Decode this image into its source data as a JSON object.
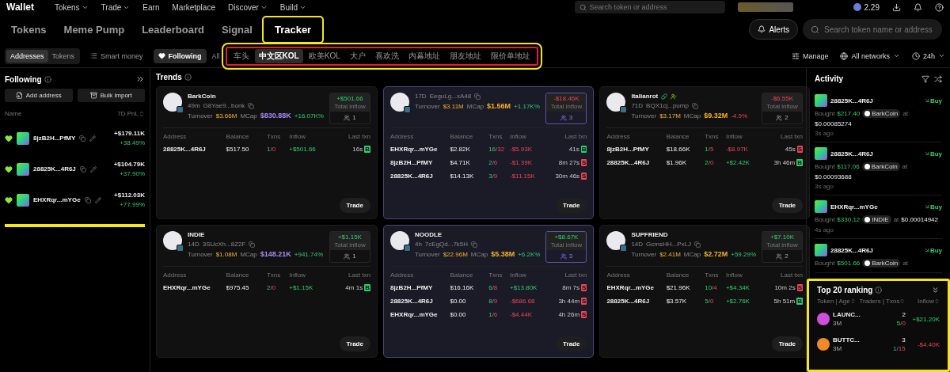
{
  "top_nav": {
    "logo": "Wallet",
    "menus": [
      {
        "label": "Tokens",
        "dropdown": true
      },
      {
        "label": "Trade",
        "dropdown": true
      },
      {
        "label": "Earn",
        "dropdown": false
      },
      {
        "label": "Marketplace",
        "dropdown": false
      },
      {
        "label": "Discover",
        "dropdown": true
      },
      {
        "label": "Build",
        "dropdown": true
      }
    ],
    "search_placeholder": "Search token or address",
    "balance": "2.29"
  },
  "tabs": [
    {
      "label": "Tokens",
      "selected": false,
      "highlighted": false
    },
    {
      "label": "Meme Pump",
      "selected": false,
      "highlighted": false
    },
    {
      "label": "Leaderboard",
      "selected": false,
      "highlighted": false
    },
    {
      "label": "Signal",
      "selected": false,
      "highlighted": false
    },
    {
      "label": "Tracker",
      "selected": true,
      "highlighted": true
    }
  ],
  "alerts_button": "Alerts",
  "search": {
    "placeholder": "Search token name or address"
  },
  "filters": {
    "segments": [
      {
        "label": "Addresses",
        "selected": true
      },
      {
        "label": "Tokens",
        "selected": false
      }
    ],
    "toggles": [
      {
        "label": "Smart money",
        "selected": false
      },
      {
        "label": "Following",
        "selected": true
      }
    ],
    "all": "All",
    "chips_highlighted": true,
    "chips": [
      {
        "label": "车头",
        "selected": false
      },
      {
        "label": "中文区KOL",
        "selected": true
      },
      {
        "label": "欧美KOL",
        "selected": false
      },
      {
        "label": "大户",
        "selected": false
      },
      {
        "label": "喜欢洗",
        "selected": false
      },
      {
        "label": "内幕地址",
        "selected": false
      },
      {
        "label": "朋友地址",
        "selected": false
      },
      {
        "label": "限价单地址",
        "selected": false
      }
    ],
    "manage": "Manage",
    "network": "All networks",
    "period": "24h"
  },
  "following": {
    "title": "Following",
    "add_button": "Add address",
    "import_button": "Bulk import",
    "col_name": "Name",
    "col_pnl": "7D PnL",
    "marked": true,
    "rows": [
      {
        "address": "8jzB2H...PfMY",
        "pnl": "+$179.11K",
        "pct": "+38.49%",
        "followed": true
      },
      {
        "address": "28825K...4R6J",
        "pnl": "+$104.79K",
        "pct": "+37.90%",
        "followed": true
      },
      {
        "address": "EHXRqr...mYGe",
        "pnl": "+$112.03K",
        "pct": "+77.99%",
        "followed": true
      }
    ]
  },
  "trends": {
    "title": "Trends",
    "cards": [
      {
        "name": "BarkCoin",
        "age": "49m",
        "address": "G8Yae9...bonk",
        "turnover_label": "Turnover",
        "turnover": "$3.66M",
        "mcap_label": "MCap",
        "mcap": {
          "value": "$830.88K",
          "color": "#a78bfa"
        },
        "change": "+16.07K%",
        "change_up": true,
        "inflow": "+$501.66",
        "inflow_up": true,
        "inflow_label": "Total inflow",
        "traders": "1",
        "selected": false,
        "tagged": false,
        "columns": [
          "Address",
          "Balance",
          "Txns",
          "Inflow",
          "Last txn"
        ],
        "trade": "Trade",
        "rows": [
          {
            "address": "28825K...4R6J",
            "balance": "$517.50",
            "txns": [
              "1",
              "/",
              "0"
            ],
            "inflow": "+$501.66",
            "up": true,
            "time": "16s",
            "side": {
              "label": "B",
              "kind": "buy"
            }
          }
        ]
      },
      {
        "age": "17D",
        "address": "EeguLg...xA48",
        "turnover_label": "Turnover",
        "turnover": "$3.11M",
        "mcap_label": "MCap",
        "mcap": {
          "value": "$1.56M",
          "color": "#f5b324"
        },
        "change": "+1.17K%",
        "change_up": true,
        "inflow": "-$18.46K",
        "inflow_up": false,
        "inflow_label": "Total inflow",
        "traders": "3",
        "selected": true,
        "tagged": false,
        "columns": [
          "Address",
          "Balance",
          "Txns",
          "Inflow",
          "Last txn"
        ],
        "trade": "Trade",
        "rows": [
          {
            "address": "EHXRqr...mYGe",
            "balance": "$2.82K",
            "txns": [
              "16",
              "/",
              "32"
            ],
            "inflow": "-$5.93K",
            "up": false,
            "time": "41s",
            "side": {
              "label": "B",
              "kind": "buy"
            }
          },
          {
            "address": "8jzB2H...PfMY",
            "balance": "$4.71K",
            "txns": [
              "2",
              "/",
              "6"
            ],
            "inflow": "-$1.39K",
            "up": false,
            "time": "8m 27s",
            "side": {
              "label": "S",
              "kind": "sell"
            }
          },
          {
            "address": "28825K...4R6J",
            "balance": "$14.13K",
            "txns": [
              "3",
              "/",
              "9"
            ],
            "inflow": "-$11.15K",
            "up": false,
            "time": "30m 46s",
            "side": {
              "label": "S",
              "kind": "sell"
            }
          }
        ]
      },
      {
        "name": "Italianrot",
        "age": "71D",
        "address": "BQX1cj...pump",
        "turnover_label": "Turnover",
        "turnover": "$3.17M",
        "mcap_label": "MCap",
        "mcap": {
          "value": "$9.32M",
          "color": "#f5b324"
        },
        "change": "-4.9%",
        "change_up": false,
        "inflow": "-$6.55K",
        "inflow_up": false,
        "inflow_label": "Total inflow",
        "traders": "2",
        "selected": false,
        "tagged": true,
        "columns": [
          "Address",
          "Balance",
          "Txns",
          "Inflow",
          "Last txn"
        ],
        "trade": "Trade",
        "rows": [
          {
            "address": "8jzB2H...PfMY",
            "balance": "$18.66K",
            "txns": [
              "1",
              "/",
              "5"
            ],
            "inflow": "-$8.97K",
            "up": false,
            "time": "45s",
            "side": {
              "label": "S",
              "kind": "sell"
            }
          },
          {
            "address": "28825K...4R6J",
            "balance": "$1.96K",
            "txns": [
              "2",
              "/",
              "0"
            ],
            "inflow": "+$2.42K",
            "up": true,
            "time": "3h 46m",
            "side": {
              "label": "B",
              "kind": "buy"
            }
          }
        ]
      },
      {
        "name": "INDIE",
        "age": "14D",
        "address": "3SUcXh...8Z2F",
        "turnover_label": "Turnover",
        "turnover": "$1.08M",
        "mcap_label": "MCap",
        "mcap": {
          "value": "$148.21K",
          "color": "#a78bfa"
        },
        "change": "+941.74%",
        "change_up": true,
        "inflow": "+$1.15K",
        "inflow_up": true,
        "inflow_label": "Total inflow",
        "traders": "1",
        "selected": false,
        "tagged": false,
        "columns": [
          "Address",
          "Balance",
          "Txns",
          "Inflow",
          "Last txn"
        ],
        "trade": "Trade",
        "rows": [
          {
            "address": "EHXRqr...mYGe",
            "balance": "$975.45",
            "txns": [
              "2",
              "/",
              "0"
            ],
            "inflow": "+$1.15K",
            "up": true,
            "time": "4m 1s",
            "side": {
              "label": "B",
              "kind": "buy"
            }
          }
        ]
      },
      {
        "name": "NOODLE",
        "age": "4h",
        "address": "7cEgQd...7k5H",
        "turnover_label": "Turnover",
        "turnover": "$22.96M",
        "mcap_label": "MCap",
        "mcap": {
          "value": "$5.38M",
          "color": "#f5b324"
        },
        "change": "+6.2K%",
        "change_up": true,
        "inflow": "+$8.67K",
        "inflow_up": true,
        "inflow_label": "Total inflow",
        "traders": "3",
        "selected": true,
        "tagged": false,
        "columns": [
          "Address",
          "Balance",
          "Txns",
          "Inflow",
          "Last txn"
        ],
        "trade": "Trade",
        "rows": [
          {
            "address": "8jzB2H...PfMY",
            "balance": "$16.16K",
            "txns": [
              "6",
              "/",
              "8"
            ],
            "inflow": "+$13.80K",
            "up": true,
            "time": "8m 7s",
            "side": {
              "label": "S",
              "kind": "sell"
            }
          },
          {
            "address": "28825K...4R6J",
            "balance": "$0.00",
            "txns": [
              "8",
              "/",
              "9"
            ],
            "inflow": "-$686.68",
            "up": false,
            "time": "3h 44m",
            "side": {
              "label": "S",
              "kind": "sell"
            }
          },
          {
            "address": "EHXRqr...mYGe",
            "balance": "$0.00",
            "txns": [
              "1",
              "/",
              "6"
            ],
            "inflow": "-$4.44K",
            "up": false,
            "time": "4h 26m",
            "side": {
              "label": "S",
              "kind": "sell"
            }
          }
        ]
      },
      {
        "name": "SUPFRIEND",
        "age": "14D",
        "address": "GcmsHH...PxLJ",
        "turnover_label": "Turnover",
        "turnover": "$2.41M",
        "mcap_label": "MCap",
        "mcap": {
          "value": "$2.72M",
          "color": "#f5b324"
        },
        "change": "+59.29%",
        "change_up": true,
        "inflow": "+$7.10K",
        "inflow_up": true,
        "inflow_label": "Total inflow",
        "traders": "2",
        "selected": false,
        "tagged": false,
        "columns": [
          "Address",
          "Balance",
          "Txns",
          "Inflow",
          "Last txn"
        ],
        "trade": "Trade",
        "rows": [
          {
            "address": "EHXRqr...mYGe",
            "balance": "$21.96K",
            "txns": [
              "10",
              "/",
              "4"
            ],
            "inflow": "+$4.34K",
            "up": true,
            "time": "10m 2s",
            "side": {
              "label": "S",
              "kind": "sell"
            }
          },
          {
            "address": "28825K...4R6J",
            "balance": "$3.57K",
            "txns": [
              "5",
              "/",
              "0"
            ],
            "inflow": "+$2.76K",
            "up": true,
            "time": "5h 51m",
            "side": {
              "label": "B",
              "kind": "buy"
            }
          }
        ]
      }
    ]
  },
  "activity": {
    "title": "Activity",
    "items": [
      {
        "address": "28825K...4R6J",
        "action": {
          "label": "Buy",
          "kind": "buy"
        },
        "verb": "Bought",
        "amount": "$217.40",
        "token": "BarkCoin",
        "at": "at",
        "price": "$0.00085274",
        "time": "3s ago"
      },
      {
        "address": "28825K...4R6J",
        "action": {
          "label": "Buy",
          "kind": "buy"
        },
        "verb": "Bought",
        "amount": "$117.06",
        "token": "BarkCoin",
        "at": "at",
        "price": "$0.00093688",
        "time": "3s ago"
      },
      {
        "address": "EHXRqr...mYGe",
        "action": {
          "label": "Buy",
          "kind": "buy"
        },
        "verb": "Bought",
        "amount": "$330.12",
        "token": "INDIE",
        "at": "at",
        "price": "$0.00014942",
        "time": "4s ago"
      },
      {
        "address": "28825K...4R6J",
        "action": {
          "label": "Buy",
          "kind": "buy"
        },
        "verb": "Bought",
        "amount": "$501.66",
        "token": "BarkCoin",
        "at": "at"
      }
    ]
  },
  "ranking": {
    "title": "Top 20 ranking",
    "highlighted": true,
    "columns": [
      "Token | Age",
      "Traders | Txns",
      "Inflow"
    ],
    "rows": [
      {
        "token": "LAUNC...",
        "age": "3M",
        "traders": "2",
        "txns": [
          "5",
          "/",
          "0"
        ],
        "inflow": "+$21.20K",
        "up": true
      },
      {
        "token": "BUTTC...",
        "age": "3M",
        "traders": "3",
        "txns": [
          "1",
          "/",
          "15"
        ],
        "inflow": "-$4.40K",
        "up": false
      }
    ]
  }
}
